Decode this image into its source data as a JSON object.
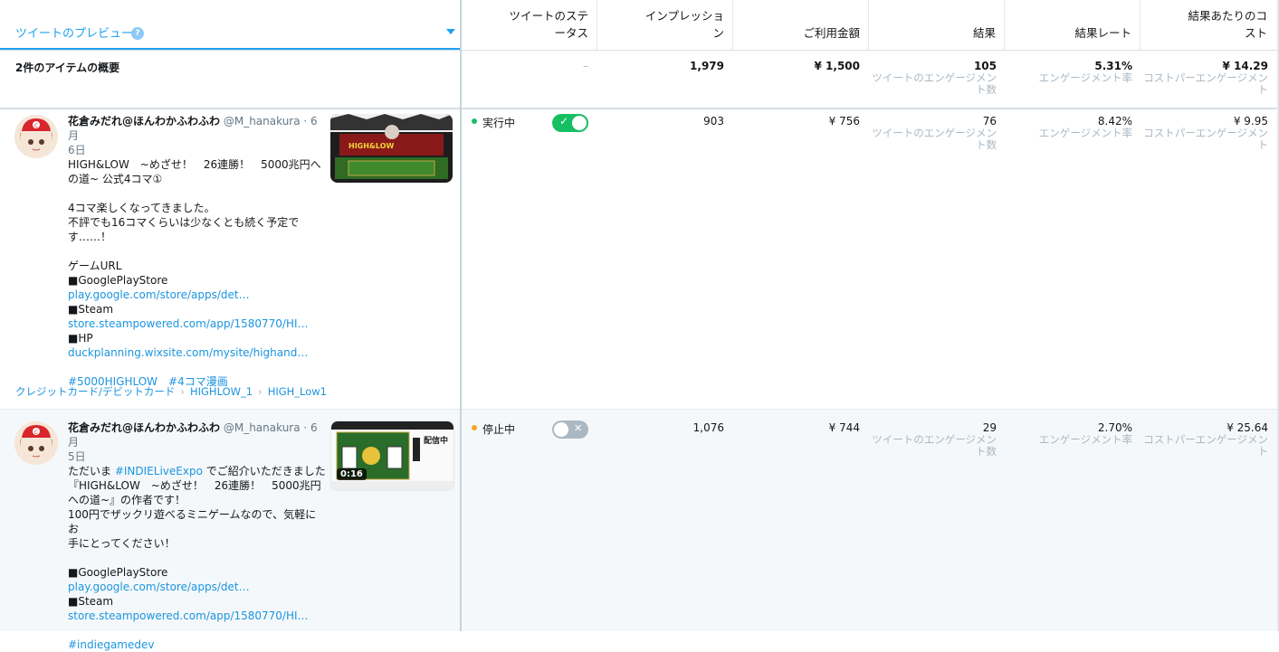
{
  "header": {
    "preview": "ツイートのプレビュー",
    "status_line1": "ツイートのステ",
    "status_line2": "ータス",
    "impressions_line1": "インプレッショ",
    "impressions_line2": "ン",
    "spend": "ご利用金額",
    "results": "結果",
    "result_rate": "結果レート",
    "cost_line1": "結果あたりのコ",
    "cost_line2": "スト"
  },
  "summary": {
    "title": "2件のアイテムの概要",
    "status": "–",
    "impressions": "1,979",
    "spend": "¥ 1,500",
    "results": "105",
    "results_sub": [
      "ツイートのエンゲージメン",
      "ト数"
    ],
    "rate": "5.31%",
    "rate_sub": "エンゲージメント率",
    "cost": "¥ 14.29",
    "cost_sub": [
      "コストパーエンゲージメン",
      "ト"
    ]
  },
  "rows": [
    {
      "author": "花倉みだれ@ほんわかふわふわ",
      "handle": "@M_hanakura · 6月",
      "date": "6日",
      "lines": [
        {
          "t": "HIGH&LOW　~めざせ！　26連勝！　5000兆円へ"
        },
        {
          "t": "の道~ 公式4コマ①"
        },
        {
          "t": ""
        },
        {
          "t": "4コマ楽しくなってきました。"
        },
        {
          "t": "不評でも16コマくらいは少なくとも続く予定で"
        },
        {
          "t": "す……！"
        },
        {
          "t": ""
        },
        {
          "t": "ゲームURL"
        },
        {
          "t": "■GooglePlayStore"
        },
        {
          "t": "play.google.com/store/apps/det…",
          "link": true
        },
        {
          "t": "■Steam"
        },
        {
          "t": "store.steampowered.com/app/1580770/HI…",
          "link": true
        },
        {
          "t": "■HP"
        },
        {
          "t": "duckplanning.wixsite.com/mysite/highand…",
          "link": true
        },
        {
          "t": ""
        },
        {
          "t": "#5000HIGHLOW　#4コマ漫画",
          "link": true
        }
      ],
      "crumbs": [
        "クレジットカード/デビットカード",
        "HIGHLOW_1",
        "HIGH_Low1"
      ],
      "status": "実行中",
      "status_color": "#17bf63",
      "toggle_on": true,
      "impressions": "903",
      "spend": "¥ 756",
      "results": "76",
      "results_sub": [
        "ツイートのエンゲージメン",
        "ト数"
      ],
      "rate": "8.42%",
      "rate_sub": "エンゲージメント率",
      "cost": "¥ 9.95",
      "cost_sub": [
        "コストパーエンゲージメン",
        "ト"
      ]
    },
    {
      "author": "花倉みだれ@ほんわかふわふわ",
      "handle": "@M_hanakura · 6月",
      "date": "5日",
      "lines": [
        {
          "t": "ただいま ",
          "link_part": "#INDIELiveExpo",
          "tail": " でご紹介いただきました"
        },
        {
          "t": "『HIGH&LOW　~めざせ！　26連勝！　5000兆円"
        },
        {
          "t": "への道~』の作者です！"
        },
        {
          "t": "100円でザックリ遊べるミニゲームなので、気軽にお"
        },
        {
          "t": "手にとってください！"
        },
        {
          "t": ""
        },
        {
          "t": "■GooglePlayStore"
        },
        {
          "t": "play.google.com/store/apps/det…",
          "link": true
        },
        {
          "t": "■Steam"
        },
        {
          "t": "store.steampowered.com/app/1580770/HI…",
          "link": true
        },
        {
          "t": ""
        },
        {
          "t": "#indiegamedev",
          "link": true
        }
      ],
      "video_time": "0:16",
      "thumb_text": "配信中",
      "status": "停止中",
      "status_color": "#f5a623",
      "toggle_on": false,
      "impressions": "1,076",
      "spend": "¥ 744",
      "results": "29",
      "results_sub": [
        "ツイートのエンゲージメン",
        "ト数"
      ],
      "rate": "2.70%",
      "rate_sub": "エンゲージメント率",
      "cost": "¥ 25.64",
      "cost_sub": [
        "コストパーエンゲージメン",
        "ト"
      ]
    }
  ],
  "colors": {
    "accent": "#1da1f2",
    "link": "#1b95e0",
    "on": "#17bf63",
    "off": "#aab8c2"
  }
}
